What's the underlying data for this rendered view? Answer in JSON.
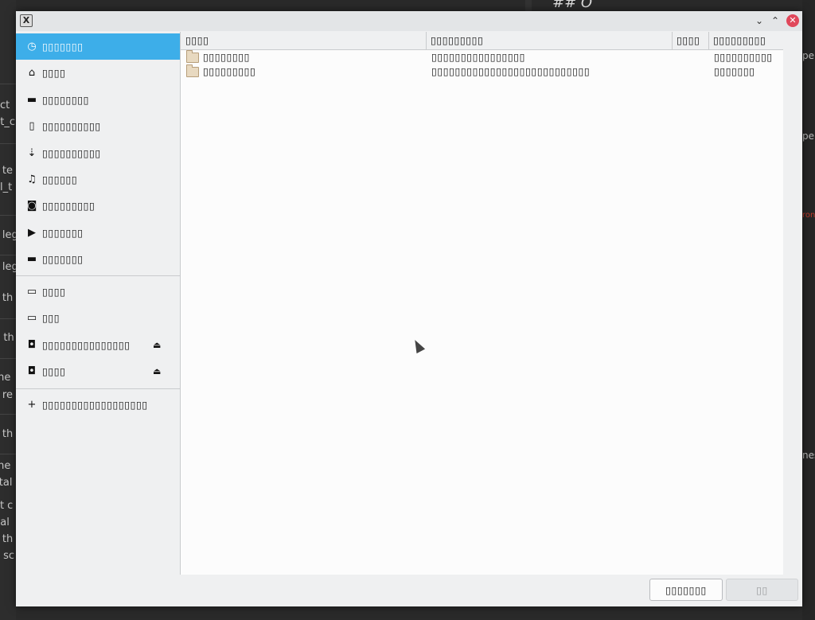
{
  "background": {
    "left_fragments": [
      "act",
      "nt_c",
      "s te",
      "al_t",
      "s leg",
      "s leg",
      "s th",
      "g th",
      "the",
      "s re",
      "s th",
      "the",
      "stal",
      "ot c",
      "nal",
      "s th",
      "e sc"
    ],
    "right_fragments": [
      "pen",
      "pen",
      "ron",
      "nes"
    ],
    "heading": "## O"
  },
  "window": {
    "app_icon_glyph": "X",
    "minimize_glyph": "⌄",
    "maximize_glyph": "⌃",
    "close_glyph": "✕",
    "close_color": "#e0475a"
  },
  "sidebar": {
    "accent": "#3daee9",
    "places": [
      {
        "icon": "clock-icon",
        "glyph": "◷",
        "label": "▯▯▯▯▯▯▯",
        "active": true
      },
      {
        "icon": "home-icon",
        "glyph": "⌂",
        "label": "▯▯▯▯"
      },
      {
        "icon": "folder-icon",
        "glyph": "▬",
        "label": "▯▯▯▯▯▯▯▯"
      },
      {
        "icon": "document-icon",
        "glyph": "▯",
        "label": "▯▯▯▯▯▯▯▯▯▯"
      },
      {
        "icon": "download-icon",
        "glyph": "⇣",
        "label": "▯▯▯▯▯▯▯▯▯▯"
      },
      {
        "icon": "music-icon",
        "glyph": "♫",
        "label": "▯▯▯▯▯▯"
      },
      {
        "icon": "camera-icon",
        "glyph": "◙",
        "label": "▯▯▯▯▯▯▯▯▯"
      },
      {
        "icon": "video-icon",
        "glyph": "▶",
        "label": "▯▯▯▯▯▯▯"
      },
      {
        "icon": "folder-icon",
        "glyph": "▬",
        "label": "▯▯▯▯▯▯▯"
      }
    ],
    "devices": [
      {
        "icon": "drive-icon",
        "glyph": "▭",
        "label": "▯▯▯▯",
        "eject": false
      },
      {
        "icon": "drive-icon",
        "glyph": "▭",
        "label": "▯▯▯",
        "eject": false
      },
      {
        "icon": "disc-icon",
        "glyph": "◘",
        "label": "▯▯▯▯▯▯▯▯▯▯▯▯▯▯▯",
        "eject": true
      },
      {
        "icon": "disc-icon",
        "glyph": "◘",
        "label": "▯▯▯▯",
        "eject": true
      }
    ],
    "eject_glyph": "⏏",
    "other": {
      "icon": "plus-icon",
      "glyph": "+",
      "label": "▯▯▯▯▯▯▯▯▯▯▯▯▯▯▯▯▯▯"
    }
  },
  "filelist": {
    "columns": [
      "▯▯▯▯",
      "▯▯▯▯▯▯▯▯▯",
      "▯▯▯▯",
      "▯▯▯▯▯▯▯▯▯"
    ],
    "rows": [
      {
        "icon": "folder-icon",
        "name": "▯▯▯▯▯▯▯▯",
        "location": "▯▯▯▯▯▯▯▯▯▯▯▯▯▯▯▯",
        "size": "",
        "modified": "▯▯▯▯▯▯▯▯▯▯"
      },
      {
        "icon": "folder-icon",
        "name": "▯▯▯▯▯▯▯▯▯",
        "location": "▯▯▯▯▯▯▯▯▯▯▯▯▯▯▯▯▯▯▯▯▯▯▯▯▯▯▯",
        "size": "",
        "modified": "▯▯▯▯▯▯▯"
      }
    ]
  },
  "footer": {
    "cancel_label": "▯▯▯▯▯▯▯",
    "open_label": "▯▯"
  }
}
